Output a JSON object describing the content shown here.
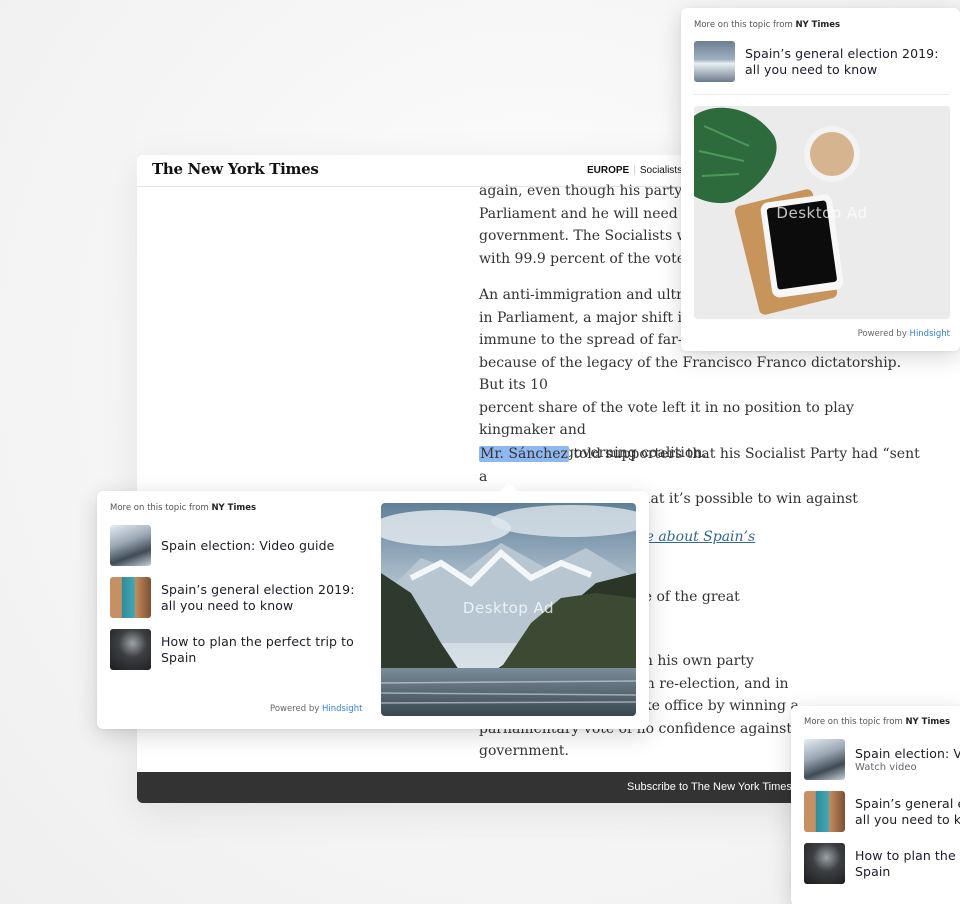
{
  "article": {
    "logo": "The New York Times",
    "section": "EUROPE",
    "section_link": "Socialists",
    "para1_lines": [
      "again, even though his party re",
      "Parliament and he will need to",
      "government. The Socialists wo",
      "with 99.9 percent of the votes c"
    ],
    "para2_lines": [
      "An anti-immigration and ultrar",
      "in Parliament, a major shift in a",
      "immune to the spread of far-rig",
      "because of the legacy of the Francisco Franco dictatorship. But its 10",
      "percent share of the vote left it in no position to play kingmaker and",
      "help form a governing coalition."
    ],
    "para3_highlight": "Mr. Sánchez",
    "para3_line1_rest": " told supporters that his Socialist Party had “sent a",
    "para3_line2": "message to the world that it’s possible to win against regression and",
    "link_text": "n four years? Read more about Spain’s",
    "para4_lines": [
      "med Mr. Sánchez as one of the great",
      "nish politics."
    ],
    "para5_lines": [
      "ago, he was ousted from his own party",
      "evolt. He eventually won re-election, and in",
      "Spanish politician to take office by winning a",
      "parliamentary vote of no confidence against the",
      "government."
    ],
    "footer": "Subscribe to The New York Times"
  },
  "popovers": {
    "heading_prefix": "More on this topic from ",
    "heading_source": "NY Times",
    "powered_prefix": "Powered by ",
    "powered_brand": "Hindsight",
    "ad_label": "Desktop Ad",
    "top": {
      "items": [
        {
          "title": "Spain’s general election 2019: all you need to know",
          "thumb": "lake-thumb"
        }
      ]
    },
    "middle": {
      "items": [
        {
          "title": "Spain election: Video guide",
          "thumb": "snow-thumb"
        },
        {
          "title": "Spain’s general election 2019: all you need to know",
          "thumb": "road-thumb"
        },
        {
          "title": "How to plan the perfect trip to Spain",
          "thumb": "travel-thumb"
        }
      ]
    },
    "bottom": {
      "items": [
        {
          "title": "Spain election: V",
          "subtitle": "Watch video",
          "thumb": "snow-thumb"
        },
        {
          "title": "Spain’s general e",
          "title2": "all you need to k",
          "thumb": "road-thumb"
        },
        {
          "title": "How to plan the",
          "title2": "Spain",
          "thumb": "travel-thumb"
        }
      ]
    }
  },
  "colors": {
    "highlight": "#8fb8f0",
    "hindsight_blue": "#2f7fd6",
    "footer_bg": "#333333",
    "link": "#326891"
  }
}
